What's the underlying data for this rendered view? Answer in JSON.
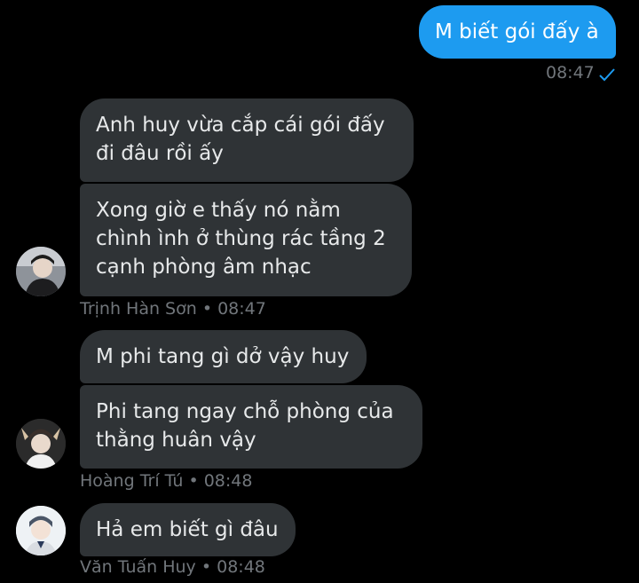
{
  "messages": {
    "outgoing": {
      "text": "M biết gói đấy à",
      "time": "08:47"
    },
    "group1": {
      "bubble1": "Anh huy vừa cắp cái gói đấy\nđi đâu rồi ấy",
      "bubble2": "Xong giờ e thấy nó nằm\nchình ình ở thùng rác tầng 2\ncạnh phòng âm nhạc",
      "sender": "Trịnh Hàn Sơn",
      "time": "08:47"
    },
    "group2": {
      "bubble1": "M phi tang gì dở vậy huy",
      "bubble2": "Phi tang ngay chỗ phòng của\nthằng huân vậy",
      "sender": "Hoàng Trí Tú",
      "time": "08:48"
    },
    "group3": {
      "bubble1": "Hả em biết gì đâu",
      "sender": "Văn Tuấn Huy",
      "time": "08:48"
    }
  },
  "meta_separator": "•",
  "colors": {
    "background": "#000000",
    "incoming_bubble": "#2f3336",
    "outgoing_bubble": "#1d9bf0",
    "meta_text": "#71767b",
    "read_check": "#1d9bf0"
  },
  "icons": {
    "read_receipt": "check-icon"
  }
}
